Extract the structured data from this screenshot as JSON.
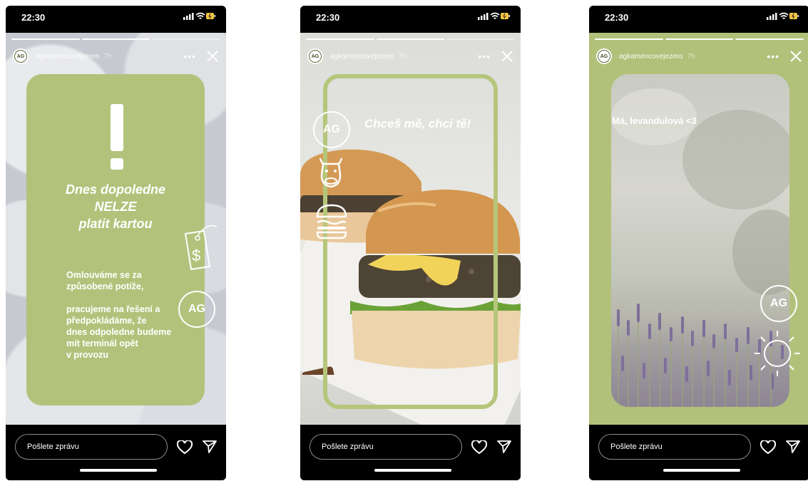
{
  "status": {
    "time": "22:30"
  },
  "stories": [
    {
      "username": "agkamencovejezero",
      "ago": "7h",
      "avatar_text": "AG"
    },
    {
      "username": "agkamencovejezero",
      "ago": "7h",
      "avatar_text": "AG"
    },
    {
      "username": "agkamencovejezero",
      "ago": "7h",
      "avatar_text": "AG"
    }
  ],
  "story1": {
    "heading": [
      "Dnes dopoledne",
      "NELZE",
      "platit kartou"
    ],
    "body1": [
      "Omlouváme se za",
      "způsobené potíže,"
    ],
    "body2": [
      "pracujeme na řešení a",
      "předpokládáme, že",
      "dnes odpoledne budeme",
      "mít terminál opět",
      "v provozu"
    ],
    "badge": "AG"
  },
  "story2": {
    "headline": "Chceš mě, chci tě!",
    "badge": "AG"
  },
  "story3": {
    "caption": "Má, levandulová <3",
    "badge": "AG"
  },
  "bottom": {
    "message_placeholder": "Pošlete zprávu"
  },
  "icons": [
    "signal-icon",
    "wifi-icon",
    "battery-icon",
    "more-icon",
    "close-icon",
    "heart-icon",
    "send-icon",
    "price-tag-icon",
    "cow-icon",
    "burger-icon",
    "sun-icon"
  ],
  "colors": {
    "accent_green": "#b3c27b",
    "frame_green": "#b5c67a"
  }
}
